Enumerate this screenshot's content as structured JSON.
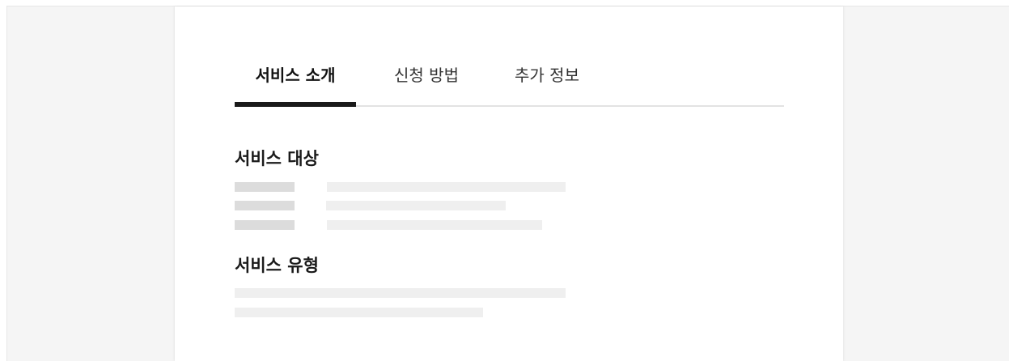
{
  "tabs": [
    {
      "label": "서비스 소개",
      "active": true
    },
    {
      "label": "신청 방법",
      "active": false
    },
    {
      "label": "추가 정보",
      "active": false
    }
  ],
  "sections": {
    "target": {
      "title": "서비스 대상"
    },
    "type": {
      "title": "서비스 유형"
    }
  },
  "colors": {
    "background": "#f5f5f5",
    "panel": "#ffffff",
    "active_tab_indicator": "#1a1a1a",
    "tab_underline": "#e3e3e3",
    "skeleton_dark": "#dcdcdc",
    "skeleton_light": "#efefef"
  }
}
